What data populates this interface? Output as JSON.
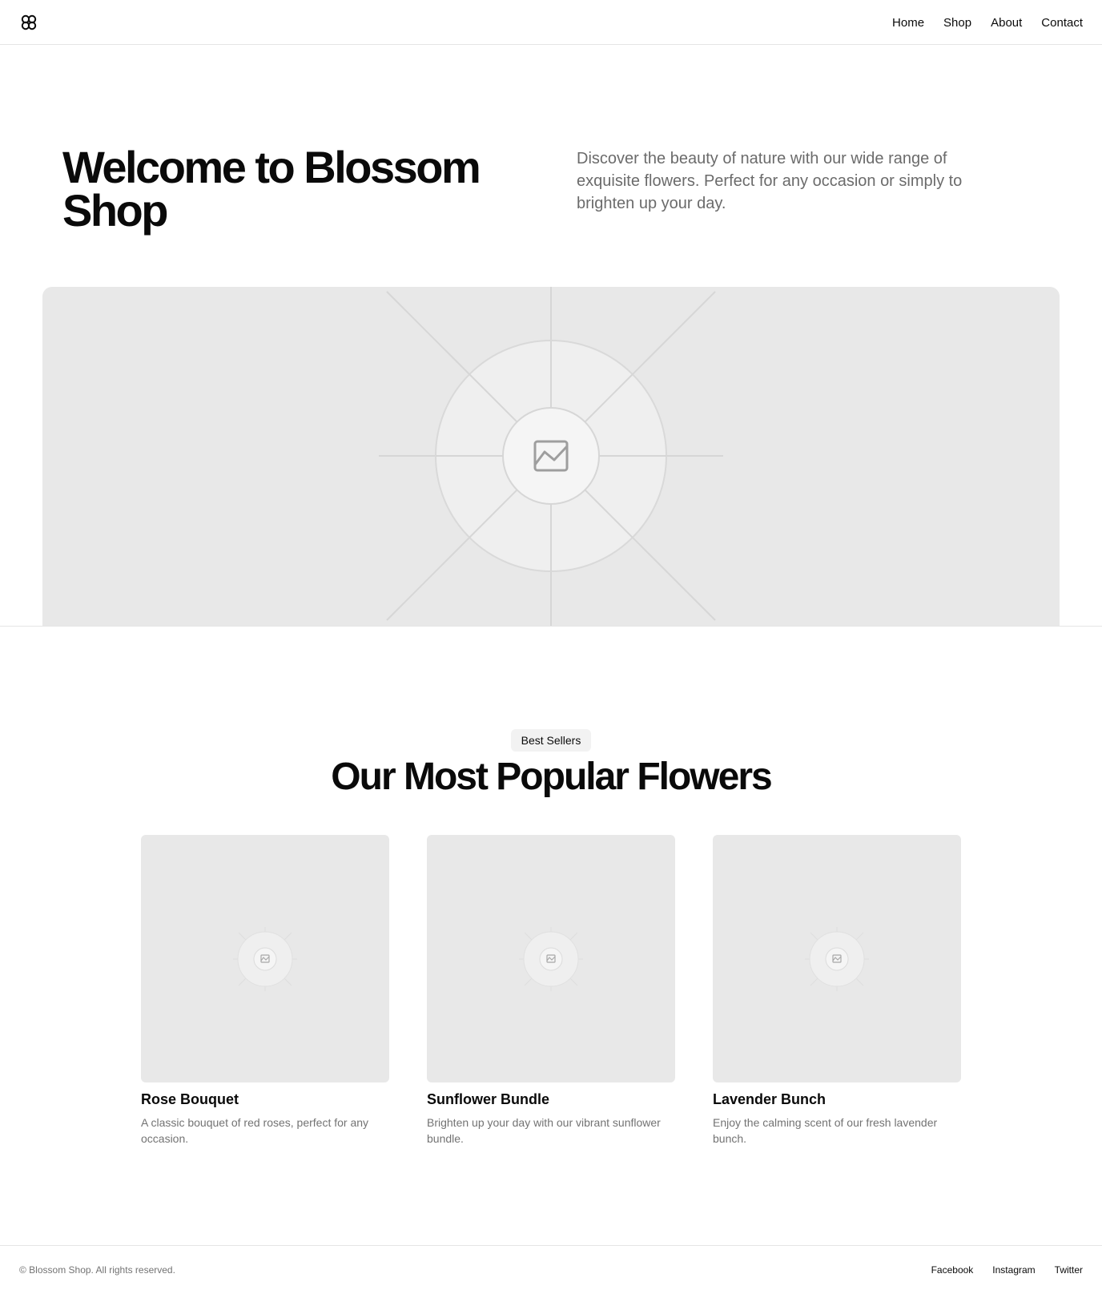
{
  "header": {
    "logo_icon": "blossom-logo-icon",
    "nav": [
      {
        "label": "Home"
      },
      {
        "label": "Shop"
      },
      {
        "label": "About"
      },
      {
        "label": "Contact"
      }
    ]
  },
  "hero": {
    "title": "Welcome to Blossom Shop",
    "description": "Discover the beauty of nature with our wide range of exquisite flowers. Perfect for any occasion or simply to brighten up your day.",
    "image_icon": "image-placeholder-icon"
  },
  "best_sellers": {
    "badge": "Best Sellers",
    "title": "Our Most Popular Flowers",
    "products": [
      {
        "name": "Rose Bouquet",
        "description": "A classic bouquet of red roses, perfect for any occasion."
      },
      {
        "name": "Sunflower Bundle",
        "description": "Brighten up your day with our vibrant sunflower bundle."
      },
      {
        "name": "Lavender Bunch",
        "description": "Enjoy the calming scent of our fresh lavender bunch."
      }
    ]
  },
  "footer": {
    "copyright": "© Blossom Shop. All rights reserved.",
    "links": [
      {
        "label": "Facebook"
      },
      {
        "label": "Instagram"
      },
      {
        "label": "Twitter"
      }
    ]
  },
  "colors": {
    "text": "#0a0a0a",
    "muted": "#737373",
    "placeholder_bg": "#e8e8e8",
    "border": "#e5e5e5"
  }
}
